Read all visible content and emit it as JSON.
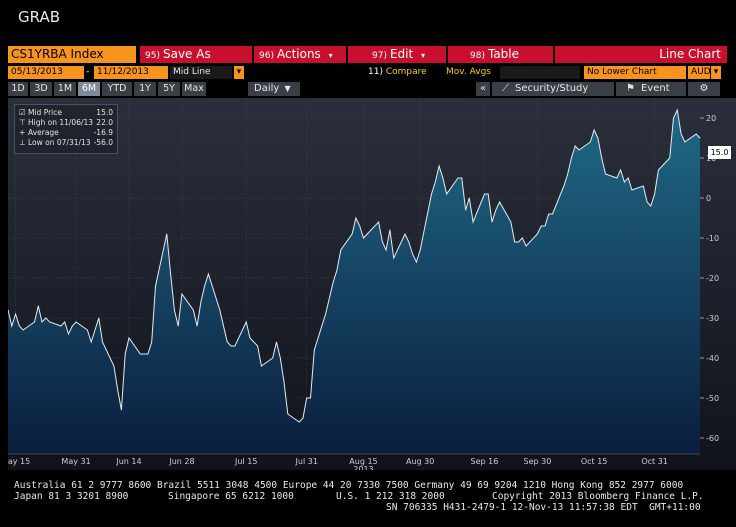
{
  "window": {
    "title": "GRAB"
  },
  "toolbar": {
    "ticker": "CS1YRBA Index",
    "save": {
      "num": "95)",
      "label": "Save As"
    },
    "actions": {
      "num": "96)",
      "label": "Actions"
    },
    "edit": {
      "num": "97)",
      "label": "Edit"
    },
    "table": {
      "num": "98)",
      "label": "Table"
    },
    "chart_type": "Line Chart"
  },
  "range": {
    "start": "05/13/2013",
    "end": "11/12/2013",
    "field": "Mid Line",
    "compare_num": "11)",
    "compare": "Compare",
    "mov_avgs": "Mov. Avgs",
    "lower_chart": "No Lower Chart",
    "currency": "AUD"
  },
  "periods": {
    "items": [
      "1D",
      "3D",
      "1M",
      "6M",
      "YTD",
      "1Y",
      "5Y",
      "Max"
    ],
    "active": "6M",
    "frequency": "Daily",
    "security_study": "Security/Study",
    "event": "Event"
  },
  "legend": {
    "rows": [
      {
        "key": "Mid Price",
        "value": "15.0"
      },
      {
        "key": "High on 11/06/13",
        "value": "22.0"
      },
      {
        "key": "Average",
        "value": "-16.9"
      },
      {
        "key": "Low on 07/31/13",
        "value": "-56.0"
      }
    ]
  },
  "last_value_tag": "15.0",
  "colors": {
    "orange": "#f7941d",
    "red": "#c8102e",
    "area_top": "#1f6a86",
    "area_bottom": "#0b1e3e"
  },
  "chart_data": {
    "type": "area",
    "ylim": [
      -64,
      25
    ],
    "yticks": [
      "20",
      "10",
      "0",
      "-10",
      "-20",
      "-30",
      "-40",
      "-50",
      "-60"
    ],
    "ytick_values": [
      20,
      10,
      0,
      -10,
      -20,
      -30,
      -40,
      -50,
      -60
    ],
    "xticks": [
      {
        "label": "May 15",
        "date": "2013-05-15"
      },
      {
        "label": "May 31",
        "date": "2013-05-31"
      },
      {
        "label": "Jun 14",
        "date": "2013-06-14"
      },
      {
        "label": "Jun 28",
        "date": "2013-06-28"
      },
      {
        "label": "Jul 15",
        "date": "2013-07-15"
      },
      {
        "label": "Jul 31",
        "date": "2013-07-31"
      },
      {
        "label": "Aug 15",
        "date": "2013-08-15"
      },
      {
        "label": "Aug 30",
        "date": "2013-08-30"
      },
      {
        "label": "Sep 16",
        "date": "2013-09-16"
      },
      {
        "label": "Sep 30",
        "date": "2013-09-30"
      },
      {
        "label": "Oct 15",
        "date": "2013-10-15"
      },
      {
        "label": "Oct 31",
        "date": "2013-10-31"
      }
    ],
    "year_label": "2013",
    "x_start": "2013-05-13",
    "x_end": "2013-11-12",
    "series": [
      {
        "points": [
          [
            "2013-05-13",
            -28
          ],
          [
            "2013-05-14",
            -32
          ],
          [
            "2013-05-15",
            -29
          ],
          [
            "2013-05-16",
            -32
          ],
          [
            "2013-05-17",
            -33
          ],
          [
            "2013-05-20",
            -31
          ],
          [
            "2013-05-21",
            -27
          ],
          [
            "2013-05-22",
            -31
          ],
          [
            "2013-05-23",
            -30
          ],
          [
            "2013-05-24",
            -31
          ],
          [
            "2013-05-27",
            -32
          ],
          [
            "2013-05-28",
            -31
          ],
          [
            "2013-05-29",
            -34
          ],
          [
            "2013-05-30",
            -32
          ],
          [
            "2013-05-31",
            -31
          ],
          [
            "2013-06-03",
            -33
          ],
          [
            "2013-06-04",
            -36
          ],
          [
            "2013-06-05",
            -33
          ],
          [
            "2013-06-06",
            -30
          ],
          [
            "2013-06-07",
            -36
          ],
          [
            "2013-06-10",
            -42
          ],
          [
            "2013-06-11",
            -48
          ],
          [
            "2013-06-12",
            -53
          ],
          [
            "2013-06-13",
            -39
          ],
          [
            "2013-06-14",
            -35
          ],
          [
            "2013-06-17",
            -39
          ],
          [
            "2013-06-18",
            -39
          ],
          [
            "2013-06-19",
            -39
          ],
          [
            "2013-06-20",
            -36
          ],
          [
            "2013-06-21",
            -22
          ],
          [
            "2013-06-24",
            -9
          ],
          [
            "2013-06-25",
            -19
          ],
          [
            "2013-06-26",
            -28
          ],
          [
            "2013-06-27",
            -32
          ],
          [
            "2013-06-28",
            -24
          ],
          [
            "2013-07-01",
            -28
          ],
          [
            "2013-07-02",
            -32
          ],
          [
            "2013-07-03",
            -26
          ],
          [
            "2013-07-04",
            -22
          ],
          [
            "2013-07-05",
            -19
          ],
          [
            "2013-07-08",
            -28
          ],
          [
            "2013-07-09",
            -32
          ],
          [
            "2013-07-10",
            -36
          ],
          [
            "2013-07-11",
            -37
          ],
          [
            "2013-07-12",
            -37
          ],
          [
            "2013-07-15",
            -31
          ],
          [
            "2013-07-16",
            -35
          ],
          [
            "2013-07-17",
            -36
          ],
          [
            "2013-07-18",
            -37
          ],
          [
            "2013-07-19",
            -42
          ],
          [
            "2013-07-22",
            -40
          ],
          [
            "2013-07-23",
            -36
          ],
          [
            "2013-07-24",
            -40
          ],
          [
            "2013-07-25",
            -46
          ],
          [
            "2013-07-26",
            -54
          ],
          [
            "2013-07-29",
            -56
          ],
          [
            "2013-07-30",
            -55
          ],
          [
            "2013-07-31",
            -50
          ],
          [
            "2013-08-01",
            -50
          ],
          [
            "2013-08-02",
            -38
          ],
          [
            "2013-08-05",
            -29
          ],
          [
            "2013-08-06",
            -25
          ],
          [
            "2013-08-07",
            -21
          ],
          [
            "2013-08-08",
            -18
          ],
          [
            "2013-08-09",
            -13
          ],
          [
            "2013-08-12",
            -9
          ],
          [
            "2013-08-13",
            -5
          ],
          [
            "2013-08-14",
            -7
          ],
          [
            "2013-08-15",
            -10
          ],
          [
            "2013-08-16",
            -9
          ],
          [
            "2013-08-19",
            -6
          ],
          [
            "2013-08-20",
            -11
          ],
          [
            "2013-08-21",
            -13
          ],
          [
            "2013-08-22",
            -8
          ],
          [
            "2013-08-23",
            -15
          ],
          [
            "2013-08-26",
            -9
          ],
          [
            "2013-08-27",
            -11
          ],
          [
            "2013-08-28",
            -14
          ],
          [
            "2013-08-29",
            -16
          ],
          [
            "2013-08-30",
            -13
          ],
          [
            "2013-09-02",
            1
          ],
          [
            "2013-09-03",
            4
          ],
          [
            "2013-09-04",
            8
          ],
          [
            "2013-09-05",
            5
          ],
          [
            "2013-09-06",
            1
          ],
          [
            "2013-09-09",
            5
          ],
          [
            "2013-09-10",
            5
          ],
          [
            "2013-09-11",
            -3
          ],
          [
            "2013-09-12",
            0
          ],
          [
            "2013-09-13",
            -6
          ],
          [
            "2013-09-16",
            1
          ],
          [
            "2013-09-17",
            1
          ],
          [
            "2013-09-18",
            -6
          ],
          [
            "2013-09-19",
            -3
          ],
          [
            "2013-09-20",
            -1
          ],
          [
            "2013-09-23",
            -6
          ],
          [
            "2013-09-24",
            -11
          ],
          [
            "2013-09-25",
            -11
          ],
          [
            "2013-09-26",
            -10
          ],
          [
            "2013-09-27",
            -12
          ],
          [
            "2013-09-30",
            -9
          ],
          [
            "2013-10-01",
            -7
          ],
          [
            "2013-10-02",
            -7
          ],
          [
            "2013-10-03",
            -4
          ],
          [
            "2013-10-04",
            -4
          ],
          [
            "2013-10-07",
            3
          ],
          [
            "2013-10-08",
            6
          ],
          [
            "2013-10-09",
            10
          ],
          [
            "2013-10-10",
            13
          ],
          [
            "2013-10-11",
            12
          ],
          [
            "2013-10-14",
            14
          ],
          [
            "2013-10-15",
            17
          ],
          [
            "2013-10-16",
            15
          ],
          [
            "2013-10-17",
            10
          ],
          [
            "2013-10-18",
            6
          ],
          [
            "2013-10-21",
            5
          ],
          [
            "2013-10-22",
            7
          ],
          [
            "2013-10-23",
            4
          ],
          [
            "2013-10-24",
            5
          ],
          [
            "2013-10-25",
            2
          ],
          [
            "2013-10-28",
            3
          ],
          [
            "2013-10-29",
            -1
          ],
          [
            "2013-10-30",
            -2
          ],
          [
            "2013-10-31",
            1
          ],
          [
            "2013-11-01",
            7
          ],
          [
            "2013-11-04",
            10
          ],
          [
            "2013-11-05",
            20
          ],
          [
            "2013-11-06",
            22
          ],
          [
            "2013-11-07",
            16
          ],
          [
            "2013-11-08",
            14
          ],
          [
            "2013-11-11",
            16
          ],
          [
            "2013-11-12",
            15
          ]
        ]
      }
    ]
  },
  "footer": {
    "line1": "Australia 61 2 9777 8600 Brazil 5511 3048 4500 Europe 44 20 7330 7500 Germany 49 69 9204 1210 Hong Kong 852 2977 6000",
    "line2a": "Japan 81 3 3201 8900",
    "line2b": "Singapore 65 6212 1000",
    "line2c": "U.S. 1 212 318 2000",
    "line2d": "Copyright 2013 Bloomberg Finance L.P.",
    "line3": "SN 706335 H431-2479-1 12-Nov-13 11:57:38 EDT  GMT+11:00"
  }
}
